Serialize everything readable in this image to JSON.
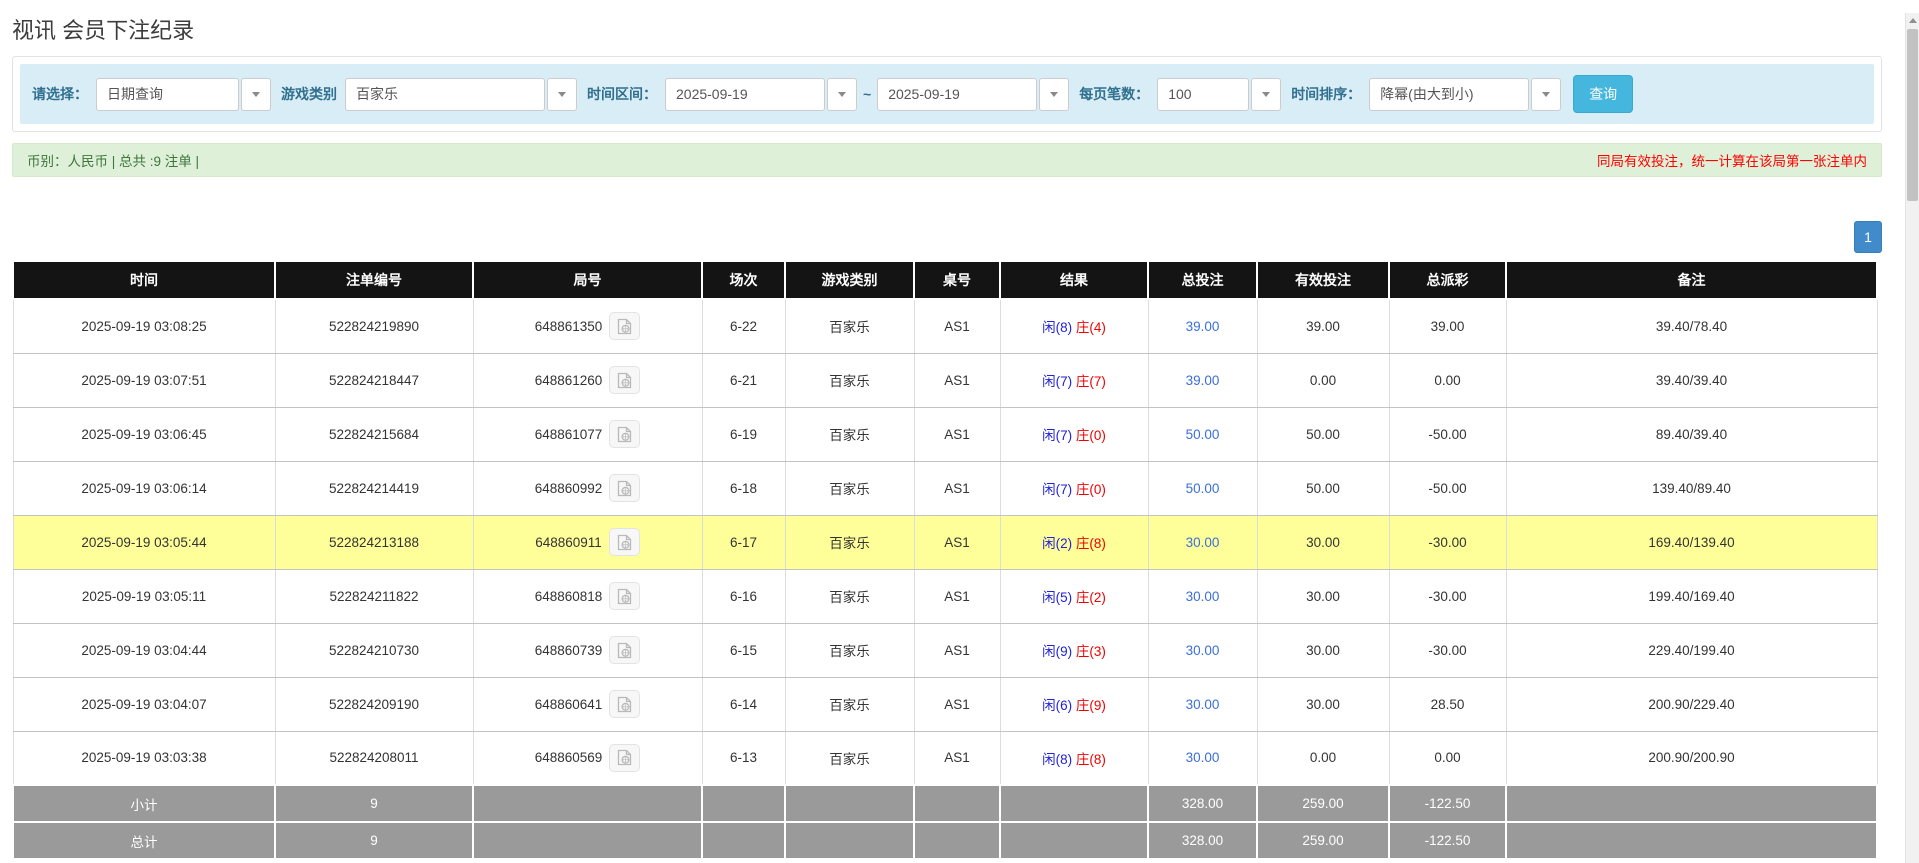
{
  "page_title": "视讯 会员下注纪录",
  "colors": {
    "accent_blue": "#45b6dd",
    "pagination_blue": "#428bca",
    "filter_bar_bg": "#d9edf7",
    "filter_label": "#31708f",
    "summary_bg": "#dff0d8",
    "summary_text": "#3c763d",
    "note_red": "#ff0000",
    "header_black": "#141414",
    "footer_gray": "#9a9a9a",
    "highlight_yellow": "#ffff99",
    "player_blue": "#2222d9",
    "banker_red": "#f00000",
    "bet_link_blue": "#3a6fd8",
    "negative_red": "#ff1414"
  },
  "filter_bar": {
    "select_label": "请选择：",
    "select_value": "日期查询",
    "game_type_label": "游戏类别",
    "game_type_value": "百家乐",
    "time_range_label": "时间区间：",
    "date_from": "2025-09-19",
    "range_separator": "~",
    "date_to": "2025-09-19",
    "page_size_label": "每页笔数：",
    "page_size_value": "100",
    "sort_label": "时间排序：",
    "sort_value": "降幂(由大到小)",
    "search_button": "查询"
  },
  "summary_bar": {
    "left_text": "币别：人民币 | 总共 :9 注单 |",
    "right_note": "同局有效投注，统一计算在该局第一张注单内"
  },
  "pagination": {
    "current_page": "1"
  },
  "table": {
    "headers": [
      "时间",
      "注单编号",
      "局号",
      "场次",
      "游戏类别",
      "桌号",
      "结果",
      "总投注",
      "有效投注",
      "总派彩",
      "备注"
    ],
    "rows": [
      {
        "time": "2025-09-19 03:08:25",
        "bet_id": "522824219890",
        "round_id": "648861350",
        "session": "6-22",
        "game": "百家乐",
        "table_no": "AS1",
        "result_player": "闲(8)",
        "result_banker": "庄(4)",
        "total_bet": "39.00",
        "valid_bet": "39.00",
        "payout": "39.00",
        "remark": "39.40/78.40",
        "highlight": false
      },
      {
        "time": "2025-09-19 03:07:51",
        "bet_id": "522824218447",
        "round_id": "648861260",
        "session": "6-21",
        "game": "百家乐",
        "table_no": "AS1",
        "result_player": "闲(7)",
        "result_banker": "庄(7)",
        "total_bet": "39.00",
        "valid_bet": "0.00",
        "payout": "0.00",
        "remark": "39.40/39.40",
        "highlight": false
      },
      {
        "time": "2025-09-19 03:06:45",
        "bet_id": "522824215684",
        "round_id": "648861077",
        "session": "6-19",
        "game": "百家乐",
        "table_no": "AS1",
        "result_player": "闲(7)",
        "result_banker": "庄(0)",
        "total_bet": "50.00",
        "valid_bet": "50.00",
        "payout": "-50.00",
        "remark": "89.40/39.40",
        "highlight": false
      },
      {
        "time": "2025-09-19 03:06:14",
        "bet_id": "522824214419",
        "round_id": "648860992",
        "session": "6-18",
        "game": "百家乐",
        "table_no": "AS1",
        "result_player": "闲(7)",
        "result_banker": "庄(0)",
        "total_bet": "50.00",
        "valid_bet": "50.00",
        "payout": "-50.00",
        "remark": "139.40/89.40",
        "highlight": false
      },
      {
        "time": "2025-09-19 03:05:44",
        "bet_id": "522824213188",
        "round_id": "648860911",
        "session": "6-17",
        "game": "百家乐",
        "table_no": "AS1",
        "result_player": "闲(2)",
        "result_banker": "庄(8)",
        "total_bet": "30.00",
        "valid_bet": "30.00",
        "payout": "-30.00",
        "remark": "169.40/139.40",
        "highlight": true
      },
      {
        "time": "2025-09-19 03:05:11",
        "bet_id": "522824211822",
        "round_id": "648860818",
        "session": "6-16",
        "game": "百家乐",
        "table_no": "AS1",
        "result_player": "闲(5)",
        "result_banker": "庄(2)",
        "total_bet": "30.00",
        "valid_bet": "30.00",
        "payout": "-30.00",
        "remark": "199.40/169.40",
        "highlight": false
      },
      {
        "time": "2025-09-19 03:04:44",
        "bet_id": "522824210730",
        "round_id": "648860739",
        "session": "6-15",
        "game": "百家乐",
        "table_no": "AS1",
        "result_player": "闲(9)",
        "result_banker": "庄(3)",
        "total_bet": "30.00",
        "valid_bet": "30.00",
        "payout": "-30.00",
        "remark": "229.40/199.40",
        "highlight": false
      },
      {
        "time": "2025-09-19 03:04:07",
        "bet_id": "522824209190",
        "round_id": "648860641",
        "session": "6-14",
        "game": "百家乐",
        "table_no": "AS1",
        "result_player": "闲(6)",
        "result_banker": "庄(9)",
        "total_bet": "30.00",
        "valid_bet": "30.00",
        "payout": "28.50",
        "remark": "200.90/229.40",
        "highlight": false
      },
      {
        "time": "2025-09-19 03:03:38",
        "bet_id": "522824208011",
        "round_id": "648860569",
        "session": "6-13",
        "game": "百家乐",
        "table_no": "AS1",
        "result_player": "闲(8)",
        "result_banker": "庄(8)",
        "total_bet": "30.00",
        "valid_bet": "0.00",
        "payout": "0.00",
        "remark": "200.90/200.90",
        "highlight": false
      }
    ],
    "footer": [
      {
        "label": "小计",
        "count": "9",
        "total_bet": "328.00",
        "valid_bet": "259.00",
        "payout": "-122.50"
      },
      {
        "label": "总计",
        "count": "9",
        "total_bet": "328.00",
        "valid_bet": "259.00",
        "payout": "-122.50"
      }
    ]
  }
}
